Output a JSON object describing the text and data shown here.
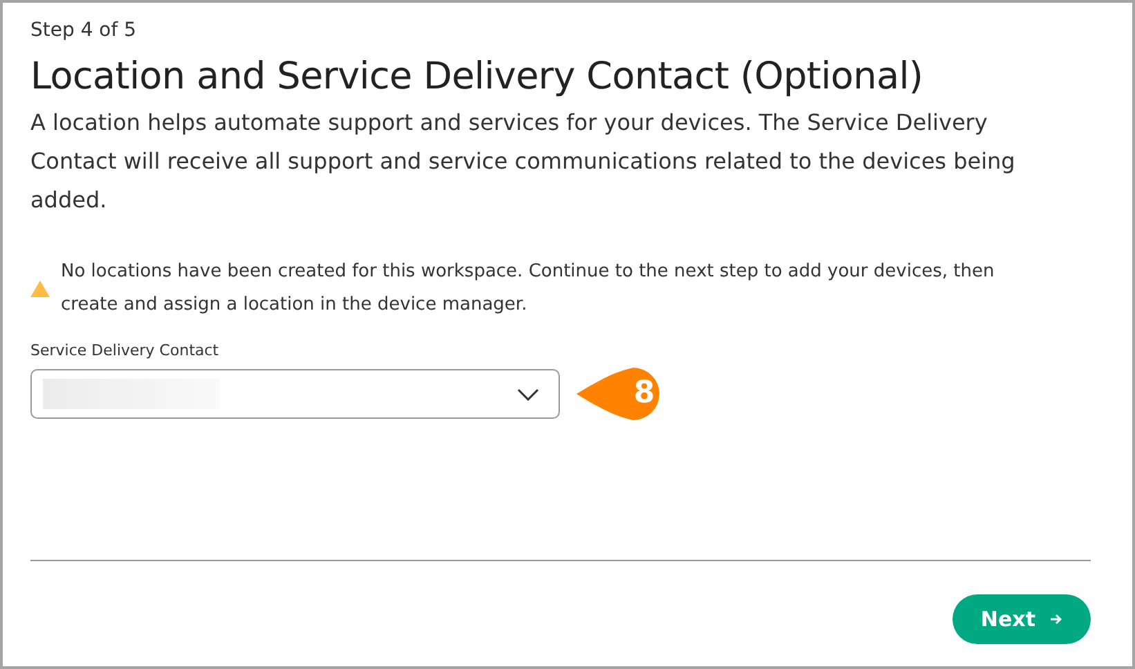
{
  "step": "Step 4 of 5",
  "title": "Location and Service Delivery Contact (Optional)",
  "description": "A location helps automate support and services for your devices. The Service Delivery Contact will receive all support and service communications related to the devices being added.",
  "warning": "No locations have been created for this workspace. Continue to the next step to add your devices, then create and assign a location in the device manager.",
  "field": {
    "label": "Service Delivery Contact",
    "value_redacted": true
  },
  "callout": "8",
  "buttons": [
    {
      "label": "Next"
    }
  ]
}
